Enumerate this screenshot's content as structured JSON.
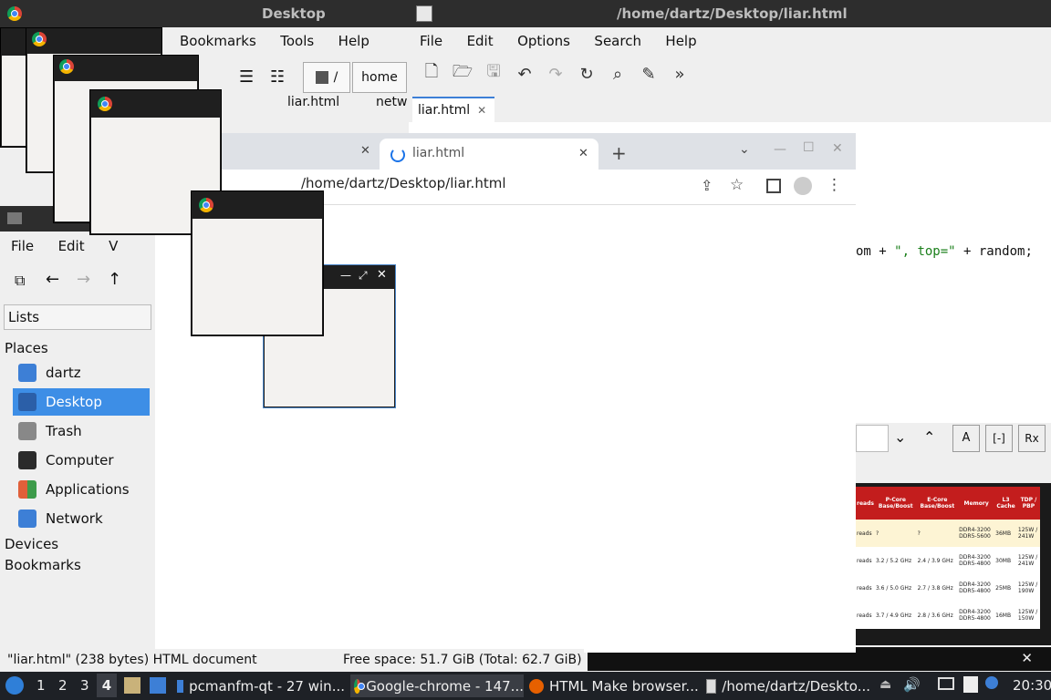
{
  "left_window": {
    "title": "Desktop",
    "menu": [
      "Bookmarks",
      "Tools",
      "Help"
    ],
    "path_segments": [
      "/",
      "home"
    ],
    "tabs": [
      "liar.html",
      "netw"
    ]
  },
  "fm_window": {
    "menu": [
      "File",
      "Edit",
      "V"
    ],
    "side_combo": "Lists",
    "places_header": "Places",
    "places": [
      {
        "label": "dartz",
        "color": "#3d7fd6"
      },
      {
        "label": "Desktop",
        "color": "#3d7fd6",
        "selected": true
      },
      {
        "label": "Trash",
        "color": "#888888"
      },
      {
        "label": "Computer",
        "color": "#2b2b2b"
      },
      {
        "label": "Applications",
        "color": "#e0603a"
      },
      {
        "label": "Network",
        "color": "#3d7fd6"
      }
    ],
    "devices_header": "Devices",
    "bookmarks_header": "Bookmarks",
    "status_left": "\"liar.html\" (238 bytes) HTML document",
    "status_right": "Free space: 51.7 GiB (Total: 62.7 GiB)",
    "partial_label": "De"
  },
  "editor": {
    "title": "/home/dartz/Desktop/liar.html",
    "menu": [
      "File",
      "Edit",
      "Options",
      "Search",
      "Help"
    ],
    "tab": "liar.html",
    "code_fragment_a": "om + ",
    "code_string_a": "\", top=\"",
    "code_fragment_b": " + random;"
  },
  "chrome": {
    "tab_title": "liar.html",
    "url": "/home/dartz/Desktop/liar.html",
    "new_tab": "+"
  },
  "cpu_table": {
    "headers": [
      "reads",
      "P-Core Base/Boost",
      "E-Core Base/Boost",
      "Memory",
      "L3 Cache",
      "TDP / PBP"
    ],
    "rows": [
      [
        "reads",
        "?",
        "?",
        "DDR4-3200 DDR5-5600",
        "36MB",
        "125W / 241W"
      ],
      [
        "reads",
        "3.2 / 5.2 GHz",
        "2.4 / 3.9 GHz",
        "DDR4-3200 DDR5-4800",
        "30MB",
        "125W / 241W"
      ],
      [
        "reads",
        "3.6 / 5.0 GHz",
        "2.7 / 3.8 GHz",
        "DDR4-3200 DDR5-4800",
        "25MB",
        "125W / 190W"
      ],
      [
        "reads",
        "3.7 / 4.9 GHz",
        "2.8 / 3.6 GHz",
        "DDR4-3200 DDR5-4800",
        "16MB",
        "125W / 150W"
      ]
    ]
  },
  "taskbar": {
    "workspaces": [
      "1",
      "2",
      "3",
      "4"
    ],
    "tasks": [
      "pcmanfm-qt - 27 win...",
      "Google-chrome - 147...",
      "HTML Make browser...",
      "/home/dartz/Deskto..."
    ],
    "clock": "20:30"
  }
}
